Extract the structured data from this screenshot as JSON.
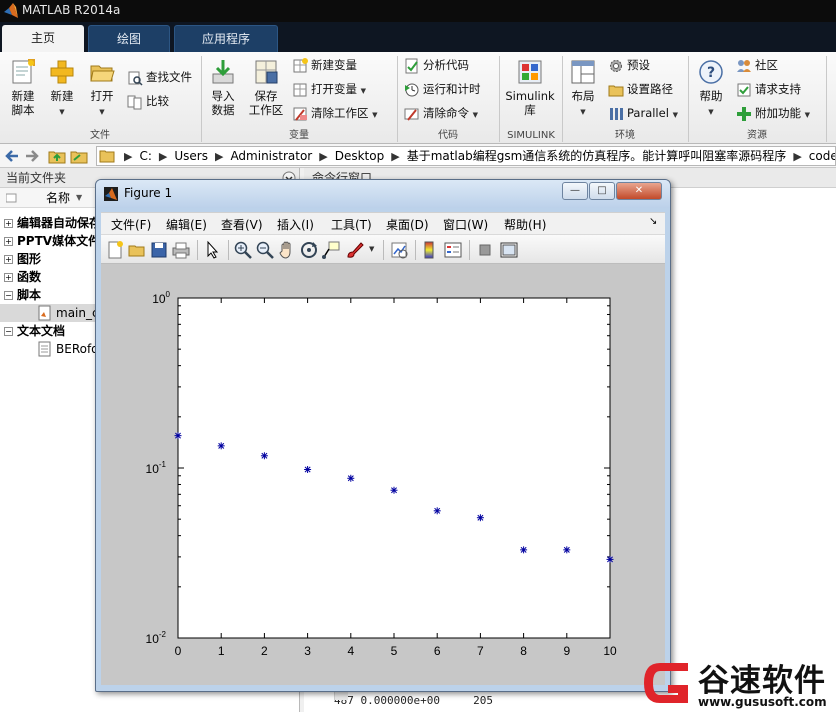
{
  "app": {
    "title": "MATLAB R2014a"
  },
  "tabs": [
    {
      "label": "主页",
      "active": true
    },
    {
      "label": "绘图",
      "active": false
    },
    {
      "label": "应用程序",
      "active": false
    }
  ],
  "ribbon": {
    "file": {
      "new_script": "新建\n脚本",
      "new": "新建",
      "open": "打开",
      "find_files": "查找文件",
      "compare": "比较",
      "section": "文件"
    },
    "variable": {
      "import_data": "导入\n数据",
      "save_workspace": "保存\n工作区",
      "new_variable": "新建变量",
      "open_variable": "打开变量",
      "clear_workspace": "清除工作区",
      "section": "变量"
    },
    "code": {
      "analyze_code": "分析代码",
      "run_and_time": "运行和计时",
      "clear_commands": "清除命令",
      "section": "代码"
    },
    "simulink": {
      "library": "Simulink\n库",
      "section": "SIMULINK"
    },
    "environment": {
      "layout": "布局",
      "preferences": "预设",
      "set_path": "设置路径",
      "parallel": "Parallel",
      "section": "环境"
    },
    "resources": {
      "help": "帮助",
      "community": "社区",
      "request_support": "请求支持",
      "add_ons": "附加功能",
      "section": "资源"
    }
  },
  "address": {
    "crumbs": [
      "C:",
      "Users",
      "Administrator",
      "Desktop",
      "基于matlab编程gsm通信系统的仿真程序。能计算呼叫阻塞率源码程序",
      "code"
    ]
  },
  "current_folder": {
    "title": "当前文件夹",
    "column": "名称",
    "items": [
      {
        "label": "编辑器自动保存",
        "type": "group"
      },
      {
        "label": "PPTV媒体文件",
        "type": "group"
      },
      {
        "label": "图形",
        "type": "group"
      },
      {
        "label": "函数",
        "type": "group"
      },
      {
        "label": "脚本",
        "type": "group-open"
      },
      {
        "label": "main_c",
        "type": "file"
      },
      {
        "label": "文本文档",
        "type": "group-open"
      },
      {
        "label": "BERofo",
        "type": "file"
      }
    ]
  },
  "command_window": {
    "title": "命令行窗口",
    "last_line": "487 0.000000e+00     205"
  },
  "figure": {
    "title": "Figure 1",
    "menu": [
      "文件(F)",
      "编辑(E)",
      "查看(V)",
      "插入(I)",
      "工具(T)",
      "桌面(D)",
      "窗口(W)",
      "帮助(H)"
    ],
    "window_buttons": {
      "minimize": "—",
      "maximize": "□",
      "close": "✕"
    }
  },
  "chart_data": {
    "type": "scatter",
    "marker": "*",
    "color": "#0000a0",
    "x": [
      0,
      1,
      2,
      3,
      4,
      5,
      6,
      7,
      8,
      9,
      10
    ],
    "y": [
      0.155,
      0.135,
      0.118,
      0.098,
      0.087,
      0.074,
      0.056,
      0.051,
      0.033,
      0.033,
      0.029
    ],
    "xlim": [
      0,
      10
    ],
    "ylim": [
      0.01,
      1
    ],
    "yscale": "log",
    "xticks": [
      "0",
      "1",
      "2",
      "3",
      "4",
      "5",
      "6",
      "7",
      "8",
      "9",
      "10"
    ],
    "yticks": [
      {
        "base": "10",
        "exp": "0"
      },
      {
        "base": "10",
        "exp": "-1"
      },
      {
        "base": "10",
        "exp": "-2"
      }
    ],
    "title": "",
    "xlabel": "",
    "ylabel": "",
    "grid": false
  },
  "watermark": {
    "text": "谷速软件",
    "url": "www.gususoft.com",
    "accent": "#e0242a"
  }
}
